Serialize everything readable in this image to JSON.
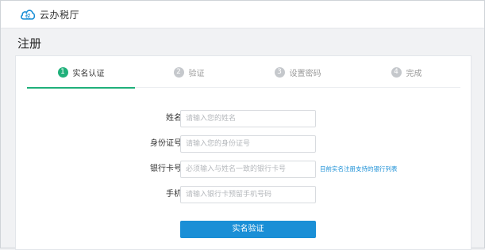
{
  "header": {
    "app_title": "云办税厅",
    "logo_icon": "cloud-tax-logo-icon"
  },
  "page": {
    "title": "注册"
  },
  "steps": [
    {
      "num": "1",
      "label": "实名认证",
      "active": true
    },
    {
      "num": "2",
      "label": "验证",
      "active": false
    },
    {
      "num": "3",
      "label": "设置密码",
      "active": false
    },
    {
      "num": "4",
      "label": "完成",
      "active": false
    }
  ],
  "form": {
    "name": {
      "label": "姓名：",
      "placeholder": "请输入您的姓名",
      "value": ""
    },
    "id_number": {
      "label": "身份证号：",
      "placeholder": "请输入您的身份证号",
      "value": ""
    },
    "bank_card": {
      "label": "银行卡号：",
      "placeholder": "必须输入与姓名一致的银行卡号",
      "value": ""
    },
    "phone": {
      "label": "手机：",
      "placeholder": "请输入银行卡预留手机号码",
      "value": ""
    },
    "bank_list_link": "目前实名注册支持的银行列表",
    "submit_label": "实名验证"
  },
  "colors": {
    "accent_green": "#1fb07a",
    "accent_blue": "#1a8fd6"
  }
}
